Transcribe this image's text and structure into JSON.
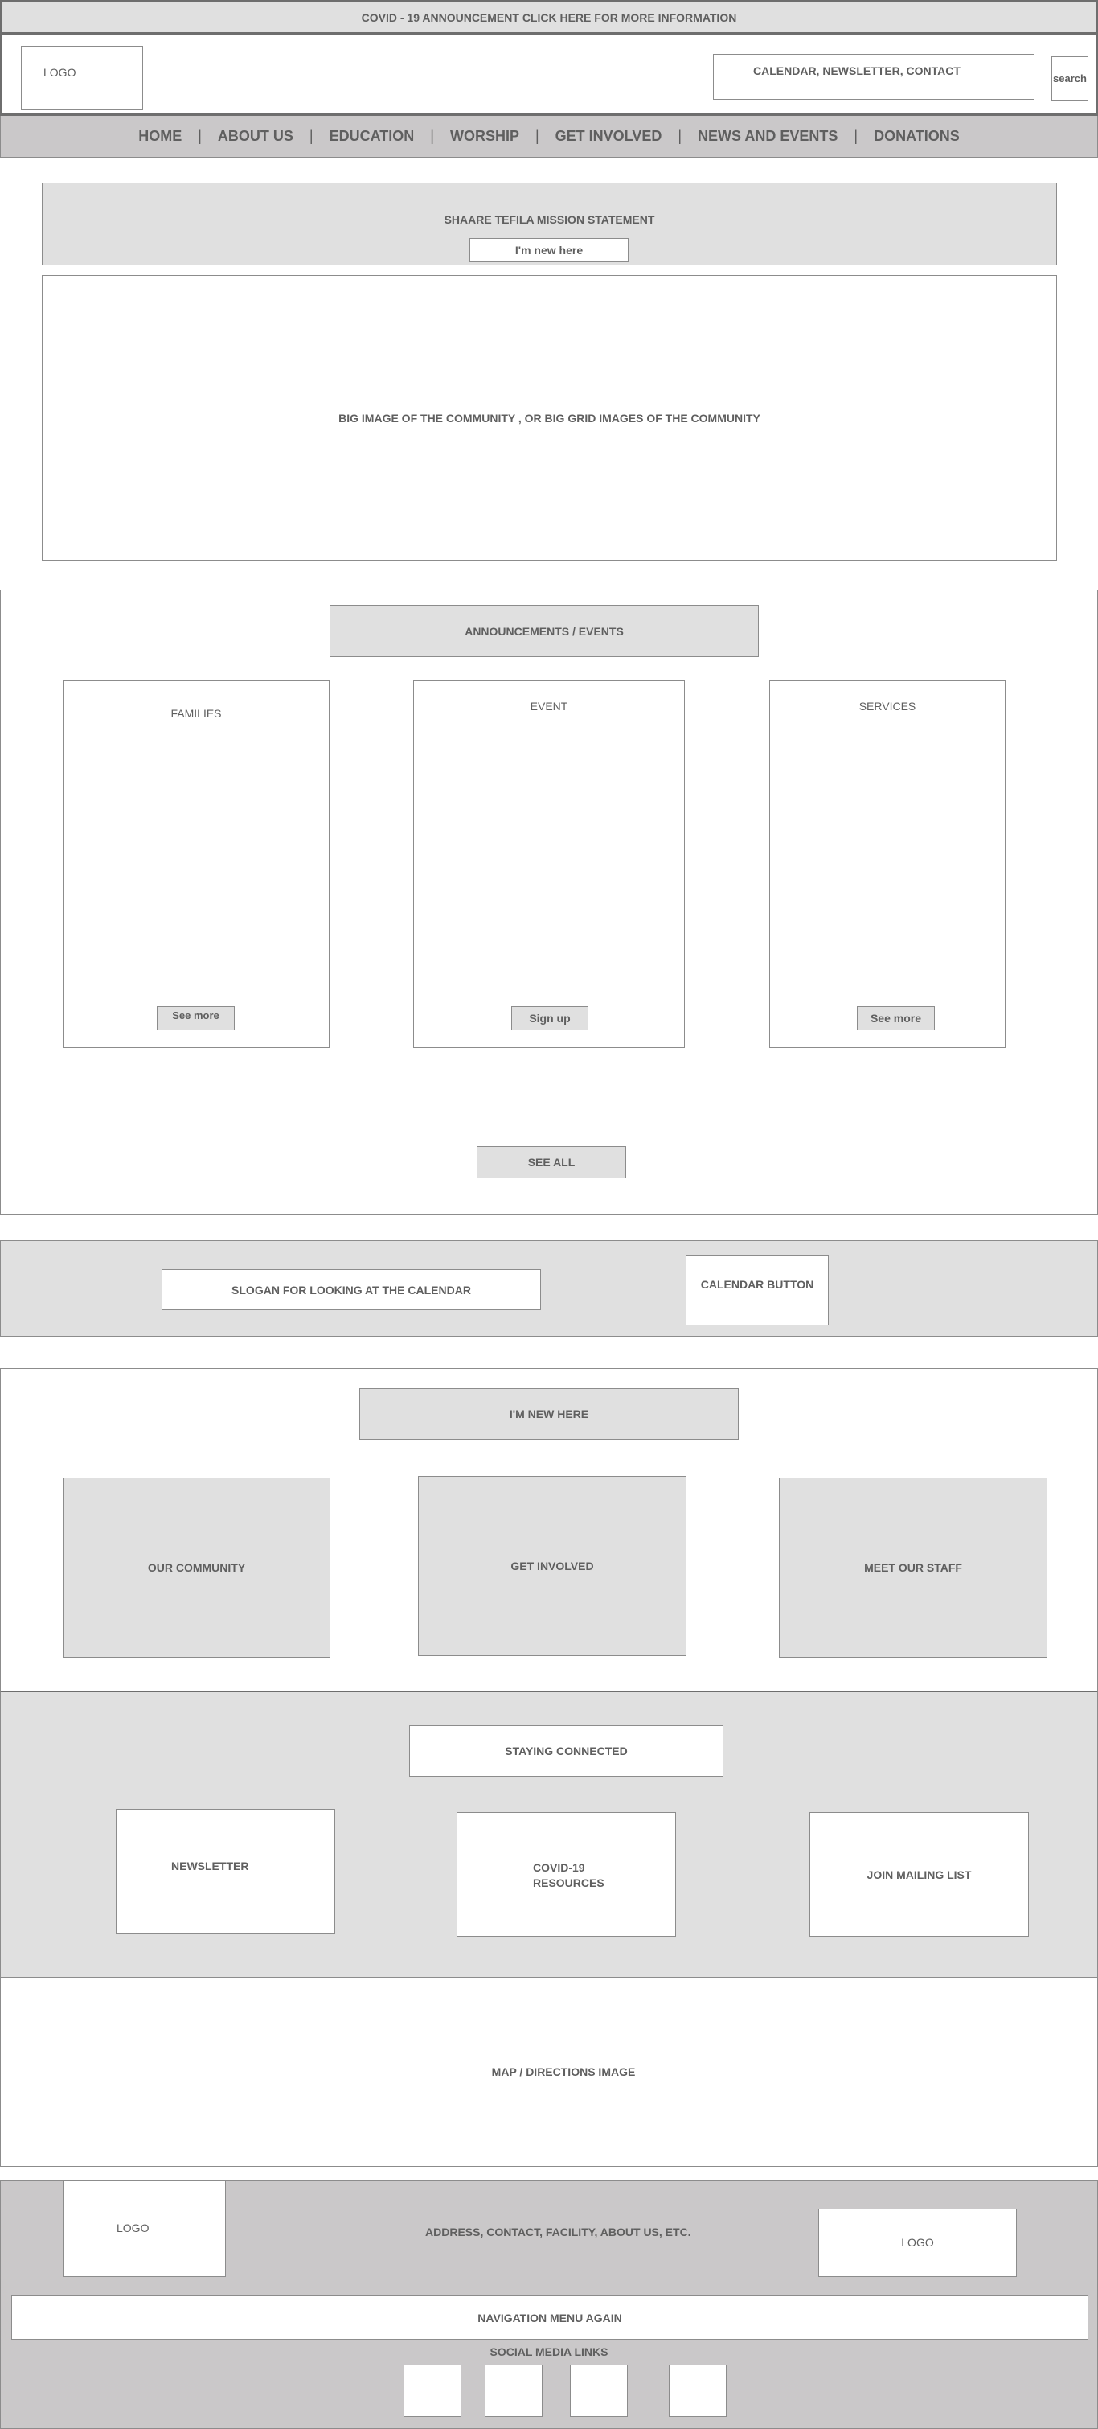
{
  "banner": {
    "text": "COVID - 19 ANNOUNCEMENT CLICK HERE FOR MORE INFORMATION"
  },
  "header": {
    "logo": "LOGO",
    "utility_links": "CALENDAR, NEWSLETTER, CONTACT",
    "search_label": "search"
  },
  "nav": {
    "items": [
      "HOME",
      "ABOUT US",
      "EDUCATION",
      "WORSHIP",
      "GET INVOLVED",
      "NEWS AND EVENTS",
      "DONATIONS"
    ],
    "separator": "|"
  },
  "mission": {
    "title": "SHAARE TEFILA MISSION STATEMENT",
    "button": "I'm new here"
  },
  "hero": {
    "text": "BIG IMAGE OF THE COMMUNITY , OR BIG GRID IMAGES OF THE COMMUNITY"
  },
  "announcements": {
    "title": "ANNOUNCEMENTS / EVENTS",
    "cards": [
      {
        "title": "FAMILIES",
        "button": "See more"
      },
      {
        "title": "EVENT",
        "button": "Sign up"
      },
      {
        "title": "SERVICES",
        "button": "See more"
      }
    ],
    "see_all": "SEE ALL"
  },
  "calendar": {
    "slogan": "SLOGAN FOR LOOKING AT THE CALENDAR",
    "button": "CALENDAR BUTTON"
  },
  "new_here": {
    "title": "I'M NEW HERE",
    "cards": [
      "OUR COMMUNITY",
      "GET INVOLVED",
      "MEET OUR STAFF"
    ]
  },
  "connected": {
    "title": "STAYING CONNECTED",
    "cards": [
      "NEWSLETTER",
      "COVID-19",
      "RESOURCES",
      "JOIN MAILING LIST"
    ]
  },
  "map": {
    "text": "MAP / DIRECTIONS IMAGE"
  },
  "footer": {
    "logo_left": "LOGO",
    "info": "ADDRESS, CONTACT, FACILITY, ABOUT US, ETC.",
    "logo_right": "LOGO",
    "nav_again": "NAVIGATION MENU AGAIN",
    "social_title": "SOCIAL MEDIA LINKS",
    "social_count": 4
  },
  "colors": {
    "light_gray": "#e0e0e0",
    "dark_gray": "#cac8c9",
    "border": "#8c8c8c",
    "text": "#5f5f5f"
  }
}
